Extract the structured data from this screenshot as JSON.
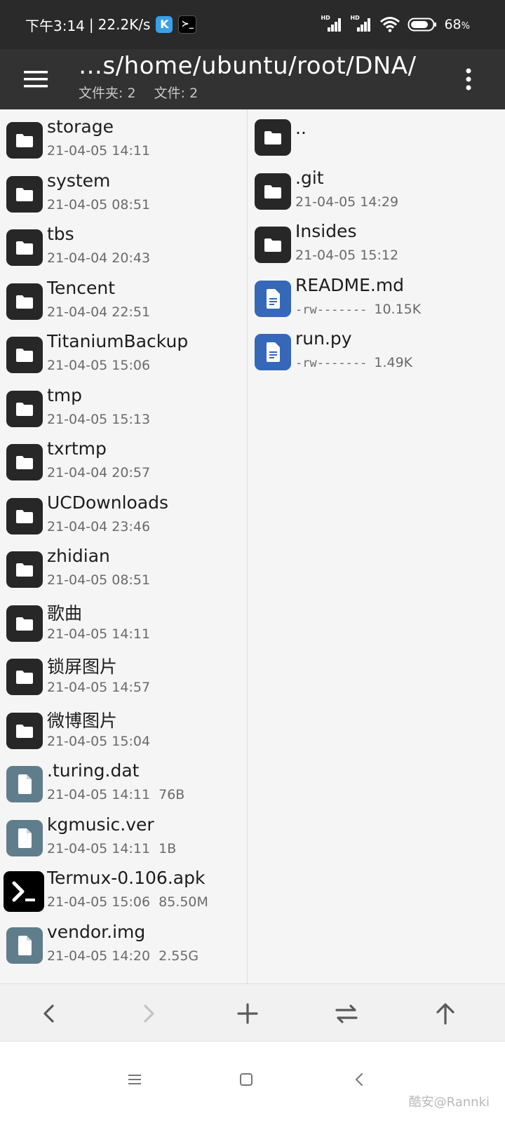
{
  "status_bar": {
    "time": "下午3:14",
    "separator": "|",
    "net_speed": "22.2K/s",
    "app_k_label": "K",
    "app_term_label": "≻_",
    "signal_1_label": "HD",
    "signal_2_label": "HD",
    "battery_value": "68",
    "battery_unit": "%"
  },
  "toolbar": {
    "path": "…s/home/ubuntu/root/DNA/",
    "folder_label": "文件夹: 2",
    "file_label": "文件: 2"
  },
  "left_pane": {
    "items": [
      {
        "name": "storage",
        "meta": "21-04-05 14:11",
        "type": "folder"
      },
      {
        "name": "system",
        "meta": "21-04-05 08:51",
        "type": "folder"
      },
      {
        "name": "tbs",
        "meta": "21-04-04 20:43",
        "type": "folder"
      },
      {
        "name": "Tencent",
        "meta": "21-04-04 22:51",
        "type": "folder"
      },
      {
        "name": "TitaniumBackup",
        "meta": "21-04-05 15:06",
        "type": "folder"
      },
      {
        "name": "tmp",
        "meta": "21-04-05 15:13",
        "type": "folder"
      },
      {
        "name": "txrtmp",
        "meta": "21-04-04 20:57",
        "type": "folder"
      },
      {
        "name": "UCDownloads",
        "meta": "21-04-04 23:46",
        "type": "folder"
      },
      {
        "name": "zhidian",
        "meta": "21-04-05 08:51",
        "type": "folder"
      },
      {
        "name": "歌曲",
        "meta": "21-04-05 14:11",
        "type": "folder"
      },
      {
        "name": "锁屏图片",
        "meta": "21-04-05 14:57",
        "type": "folder"
      },
      {
        "name": "微博图片",
        "meta": "21-04-05 15:04",
        "type": "folder"
      },
      {
        "name": ".turing.dat",
        "meta": "21-04-05 14:11  76B",
        "type": "file"
      },
      {
        "name": "kgmusic.ver",
        "meta": "21-04-05 14:11  1B",
        "type": "file"
      },
      {
        "name": "Termux-0.106.apk",
        "meta": "21-04-05 15:06  85.50M",
        "type": "apk"
      },
      {
        "name": "vendor.img",
        "meta": "21-04-05 14:20  2.55G",
        "type": "file"
      }
    ]
  },
  "right_pane": {
    "items": [
      {
        "name": "..",
        "meta": "",
        "type": "folder"
      },
      {
        "name": ".git",
        "meta": "21-04-05 14:29",
        "type": "folder"
      },
      {
        "name": "Insides",
        "meta": "21-04-05 15:12",
        "type": "folder"
      },
      {
        "name": "README.md",
        "perm": "-rw-------",
        "size": "10.15K",
        "type": "doc"
      },
      {
        "name": "run.py",
        "perm": "-rw-------",
        "size": "1.49K",
        "type": "doc"
      }
    ]
  },
  "bottom_bar": {
    "icons": [
      "back-icon",
      "forward-icon",
      "add-icon",
      "swap-icon",
      "up-icon"
    ],
    "forward_disabled_color": "#c4c4c4",
    "active_color": "#5a5a5a"
  },
  "watermark": "酷安@Rannki",
  "colors": {
    "status_bar": "#2a2a2a",
    "toolbar": "#323232",
    "folder_tile": "#272727",
    "file_tile": "#607d8b",
    "doc_tile": "#3568b8"
  }
}
